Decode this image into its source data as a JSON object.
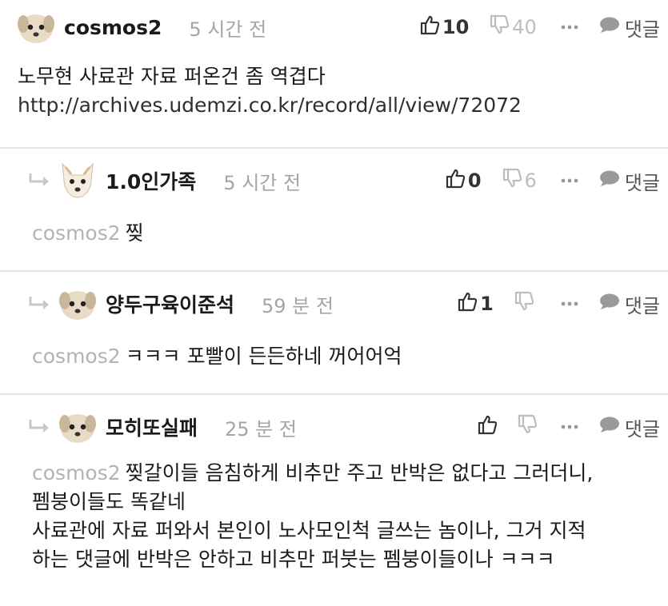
{
  "comments": [
    {
      "nickname": "cosmos2",
      "time": "5 시간 전",
      "up": "10",
      "down": "40",
      "reply_label": "댓글",
      "text": "노무현 사료관 자료 퍼온건 좀 역겹다",
      "link": "http://archives.udemzi.co.kr/record/all/view/72072"
    },
    {
      "nickname": "1.0인가족",
      "time": "5 시간 전",
      "up": "0",
      "down": "6",
      "reply_label": "댓글",
      "mention": "cosmos2",
      "text": "찢"
    },
    {
      "nickname": "양두구육이준석",
      "time": "59 분 전",
      "up": "1",
      "down": "",
      "reply_label": "댓글",
      "mention": "cosmos2",
      "text": "ㅋㅋㅋ 포빨이 든든하네 꺼어어억"
    },
    {
      "nickname": "모히또실패",
      "time": "25 분 전",
      "up": "",
      "down": "",
      "reply_label": "댓글",
      "mention": "cosmos2",
      "lines": [
        "찢갈이들 음침하게 비추만 주고 반박은 없다고 그러더니,",
        "펨붕이들도 똑같네",
        "사료관에 자료 퍼와서 본인이 노사모인척 글쓰는 놈이나, 그거 지적",
        "하는 댓글에 반박은 안하고 비추만 퍼붓는 펨붕이들이나 ㅋㅋㅋ"
      ]
    }
  ],
  "icons": {
    "thumbs_up": "thumbs-up-icon",
    "thumbs_down": "thumbs-down-icon",
    "more": "more-icon",
    "reply": "speech-bubble-icon",
    "reply_arrow": "reply-arrow-icon",
    "avatar": "dog-avatar"
  },
  "colors": {
    "muted": "#a5a5a5",
    "mention": "#b3b3b3",
    "divider": "#e6e6e6"
  }
}
